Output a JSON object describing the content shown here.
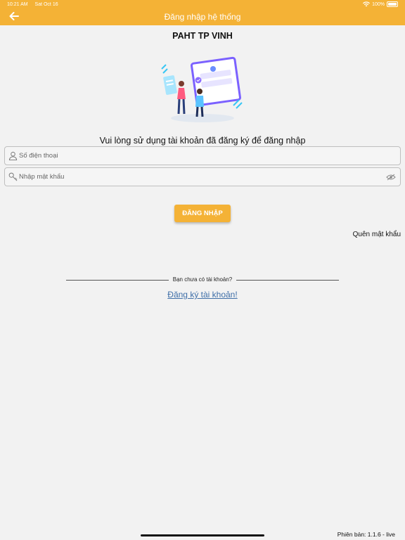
{
  "status_bar": {
    "time": "10:21 AM",
    "date": "Sat Oct 16",
    "battery": "100%"
  },
  "header": {
    "title": "Đăng nhập hệ thống",
    "background": "#f4b236",
    "back_icon": "arrow-left-icon"
  },
  "app_title": "PAHT TP VINH",
  "prompt": "Vui lòng sử dụng tài khoản đã đăng ký để đăng nhập",
  "form": {
    "phone": {
      "placeholder": "Số điện thoại",
      "value": "",
      "icon": "user-icon"
    },
    "password": {
      "placeholder": "Nhập mật khẩu",
      "value": "",
      "icon": "key-icon",
      "toggle_icon": "eye-icon"
    },
    "login_label": "ĐĂNG NHẬP",
    "forgot_label": "Quên mật khẩu"
  },
  "signup": {
    "question": "Bạn chưa có tài khoản?",
    "link_label": "Đăng ký tài khoản!"
  },
  "footer": {
    "version": "Phiên bản: 1.1.6 - live"
  },
  "colors": {
    "accent": "#f4b236",
    "link": "#3f6fa8",
    "background": "#f2f2f2"
  }
}
